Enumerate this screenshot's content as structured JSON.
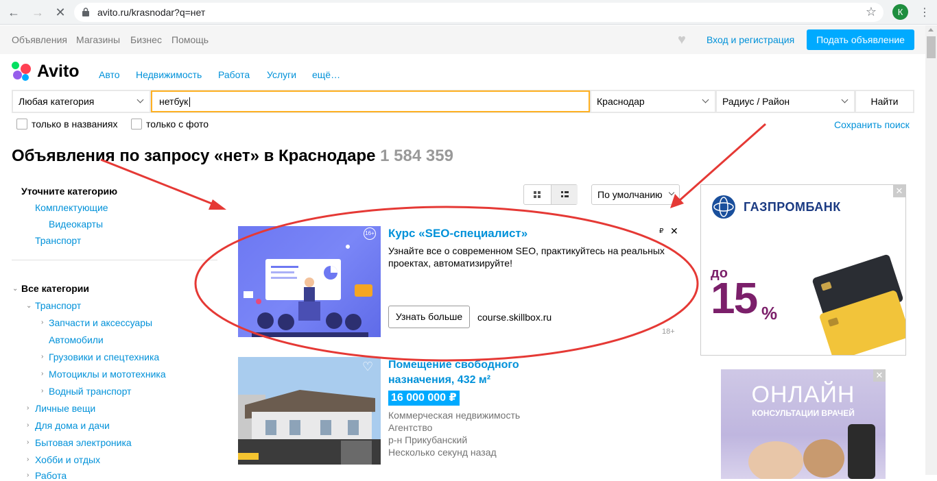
{
  "browser": {
    "url": "avito.ru/krasnodar?q=нет",
    "profile_initial": "К"
  },
  "topnav": {
    "links": [
      "Объявления",
      "Магазины",
      "Бизнес",
      "Помощь"
    ],
    "login": "Вход и регистрация",
    "post_button": "Подать объявление"
  },
  "logo": {
    "word": "Avito"
  },
  "categories": [
    "Авто",
    "Недвижимость",
    "Работа",
    "Услуги",
    "ещё…"
  ],
  "search": {
    "category": "Любая категория",
    "query": "нетбук",
    "city": "Краснодар",
    "radius": "Радиус / Район",
    "find": "Найти",
    "only_titles": "только в названиях",
    "only_photo": "только с фото",
    "save": "Сохранить поиск"
  },
  "heading": {
    "text": "Объявления по запросу «нет» в Краснодаре",
    "count": "1 584 359"
  },
  "sidebar": {
    "refine_title": "Уточните категорию",
    "refine_links": [
      "Комплектующие",
      "Видеокарты",
      "Транспорт"
    ],
    "all_title": "Все категории",
    "transport": "Транспорт",
    "transport_children": [
      "Запчасти и аксессуары",
      "Автомобили",
      "Грузовики и спецтехника",
      "Мотоциклы и мототехника",
      "Водный транспорт"
    ],
    "top_categories": [
      "Личные вещи",
      "Для дома и дачи",
      "Бытовая электроника",
      "Хобби и отдых",
      "Работа"
    ]
  },
  "sort": {
    "selected": "По умолчанию"
  },
  "ad": {
    "title": "Курс «SEO-специалист»",
    "description": "Узнайте все о современном SEO, практикуйтесь на реальных проектах, автоматизируйте!",
    "button": "Узнать больше",
    "domain": "course.skillbox.ru",
    "age": "18+",
    "age_badge": "16+",
    "rub": "₽",
    "close": "✕"
  },
  "listing": {
    "title": "Помещение свободного назначения, 432 м²",
    "price": "16 000 000 ₽",
    "category": "Коммерческая недвижимость",
    "seller": "Агентство",
    "district": "р-н Прикубанский",
    "time": "Несколько секунд назад"
  },
  "banners": {
    "gpb_name": "ГАЗПРОМБАНК",
    "gpb_do": "до",
    "gpb_num": "15",
    "gpb_pct": "%",
    "online_title": "ОНЛАЙН",
    "online_sub": "КОНСУЛЬТАЦИИ ВРАЧЕЙ"
  },
  "colors": {
    "accent": "#0091d9",
    "button": "#00aaff",
    "search_focus": "#ffb021",
    "annotation": "#e53935"
  }
}
